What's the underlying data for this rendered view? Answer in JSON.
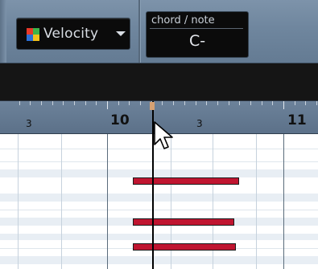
{
  "toolbar": {
    "velocity_dropdown": {
      "label": "Velocity",
      "icon": "color-grid-icon",
      "icon_colors": [
        "#e8392a",
        "#3cb44a",
        "#2b6fd6",
        "#f2c21b"
      ]
    },
    "chord_display": {
      "title": "chord / note",
      "value": "C-"
    }
  },
  "ruler": {
    "labels": [
      {
        "text": "3",
        "kind": "beat"
      },
      {
        "text": "10",
        "kind": "bar"
      },
      {
        "text": "3",
        "kind": "beat"
      },
      {
        "text": "11",
        "kind": "bar"
      }
    ]
  },
  "notes": [
    {
      "name": "note-1"
    },
    {
      "name": "note-2"
    },
    {
      "name": "note-3"
    }
  ],
  "colors": {
    "note_fill": "#c01530",
    "toolbar_bg": "#6f869e",
    "ruler_bg": "#647a92",
    "playhead_marker": "#d5a173"
  }
}
